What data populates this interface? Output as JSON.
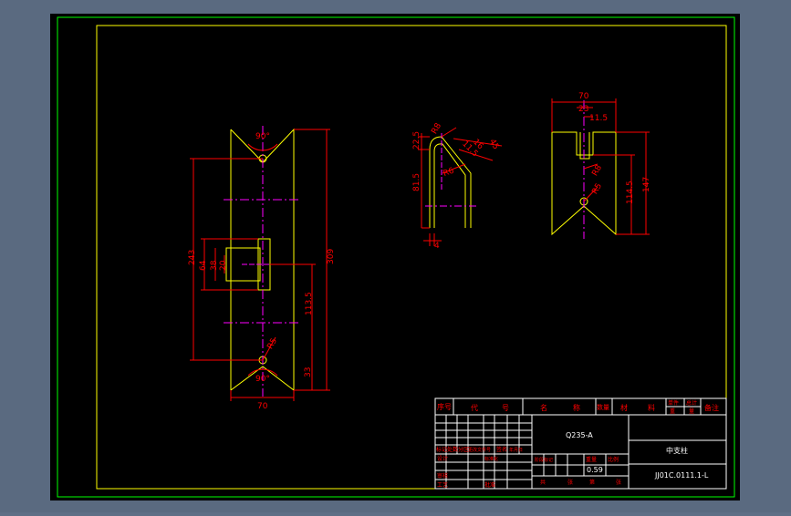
{
  "colors": {
    "background": "#000000",
    "frame": "#00ff00",
    "outline": "#ffff00",
    "dimension": "#ff0000",
    "center_line": "#ff00ff",
    "text": "#ffffff",
    "app_bg": "#5a6a80"
  },
  "view_front": {
    "angle_top": "90°",
    "angle_bottom": "90°",
    "dim_overall_height": "309",
    "dim_hole_spacing": "243",
    "dim_slot_height": "64",
    "dim_slot_inner": "38",
    "dim_slot_small": "20",
    "dim_to_slot": "113.5",
    "dim_bottom": "33",
    "dim_width": "70",
    "dim_radius": "R5"
  },
  "view_side": {
    "dim_top": "22.5",
    "dim_r_outer": "R8",
    "dim_r_inner": "R6",
    "dim_vertical": "81.5",
    "dim_angle_label": "45",
    "dim_thickness": "4",
    "dim_side_a": "11.5",
    "dim_side_b": "16"
  },
  "view_end": {
    "dim_width": "70",
    "dim_slot": "23",
    "dim_slot_top": "11.5",
    "dim_height": "147",
    "dim_inner_height": "114.5",
    "dim_r": "R8",
    "dim_r_small": "R5"
  },
  "title_block": {
    "header": [
      "序号",
      "代",
      "号",
      "名",
      "称",
      "数量",
      "材",
      "料",
      "单件",
      "总计",
      "备注"
    ],
    "weight_labels": [
      "重",
      "量"
    ],
    "material": "Q235-A",
    "part_name": "中支柱",
    "drawing_number": "JJ01C.0111.1-L",
    "weight": "0.59",
    "labels": {
      "marks": "标记",
      "count": "处数",
      "zone": "分区",
      "change_doc": "更改文件号",
      "signature": "签名",
      "date": "年月日",
      "stage_mark": "阶段标记",
      "weight_col": "重量",
      "scale": "比例",
      "design": "设计",
      "standardize": "标准化",
      "proofread": "审核",
      "craft": "工艺",
      "approve": "批准",
      "sheet_total": "共",
      "sheet_total_unit": "张",
      "sheet_no": "第",
      "sheet_no_unit": "张"
    }
  }
}
